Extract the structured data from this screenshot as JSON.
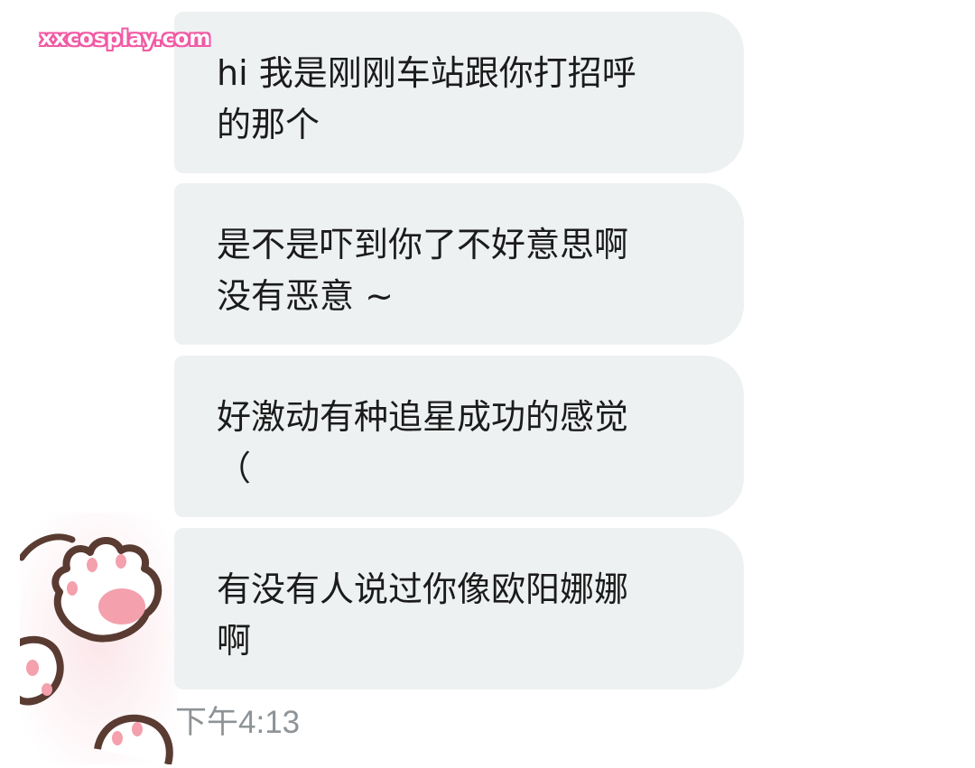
{
  "watermark": "xxcosplay.com",
  "avatar": {
    "icon": "cat-paw-icon",
    "paw_color": "#f4a7b9",
    "outline_color": "#5a3b32"
  },
  "messages": [
    {
      "text": "hi 我是刚刚车站跟你打招呼\n的那个"
    },
    {
      "text": "是不是吓到你了不好意思啊\n没有恶意 ~"
    },
    {
      "text": "好激动有种追星成功的感觉\n（"
    },
    {
      "text": "有没有人说过你像欧阳娜娜\n啊"
    }
  ],
  "timestamp": "下午4:13",
  "colors": {
    "bubble": "#eef1f2",
    "text": "#1b1b1b",
    "timestamp": "#8d9396",
    "watermark": "#f15aa4"
  }
}
